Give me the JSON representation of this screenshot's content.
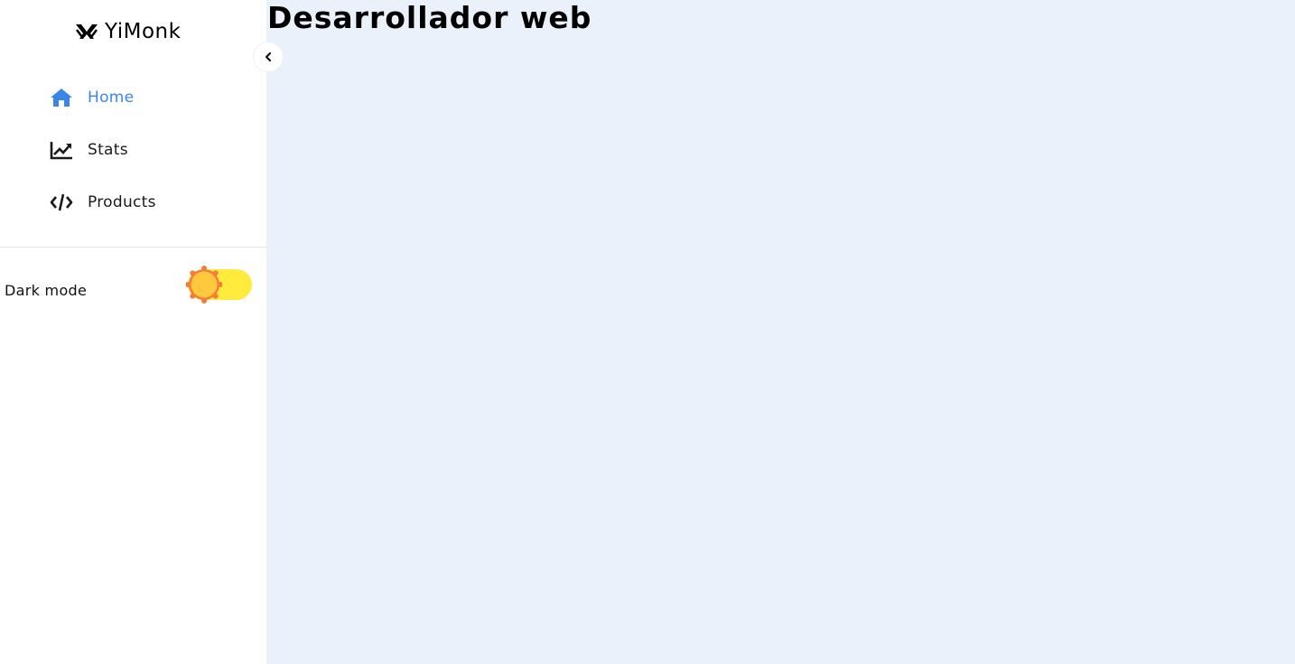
{
  "brand": {
    "name": "YiMonk",
    "logo_icon": "monk-logo-icon"
  },
  "collapse": {
    "icon": "chevron-left-icon"
  },
  "sidebar": {
    "items": [
      {
        "label": "Home",
        "icon": "home-icon",
        "active": true
      },
      {
        "label": "Stats",
        "icon": "chart-line-icon",
        "active": false
      },
      {
        "label": "Products",
        "icon": "code-icon",
        "active": false
      }
    ]
  },
  "theme": {
    "dark_mode_label": "Dark mode",
    "dark_mode_on": false,
    "toggle_color": "#ffeb3b",
    "sun_color": "#ffc83d",
    "sun_border_color": "#f57c3a"
  },
  "main": {
    "title": "Desarrollador web"
  },
  "colors": {
    "accent": "#3a86e8",
    "background": "#eaf1fa",
    "sidebar": "#ffffff"
  }
}
